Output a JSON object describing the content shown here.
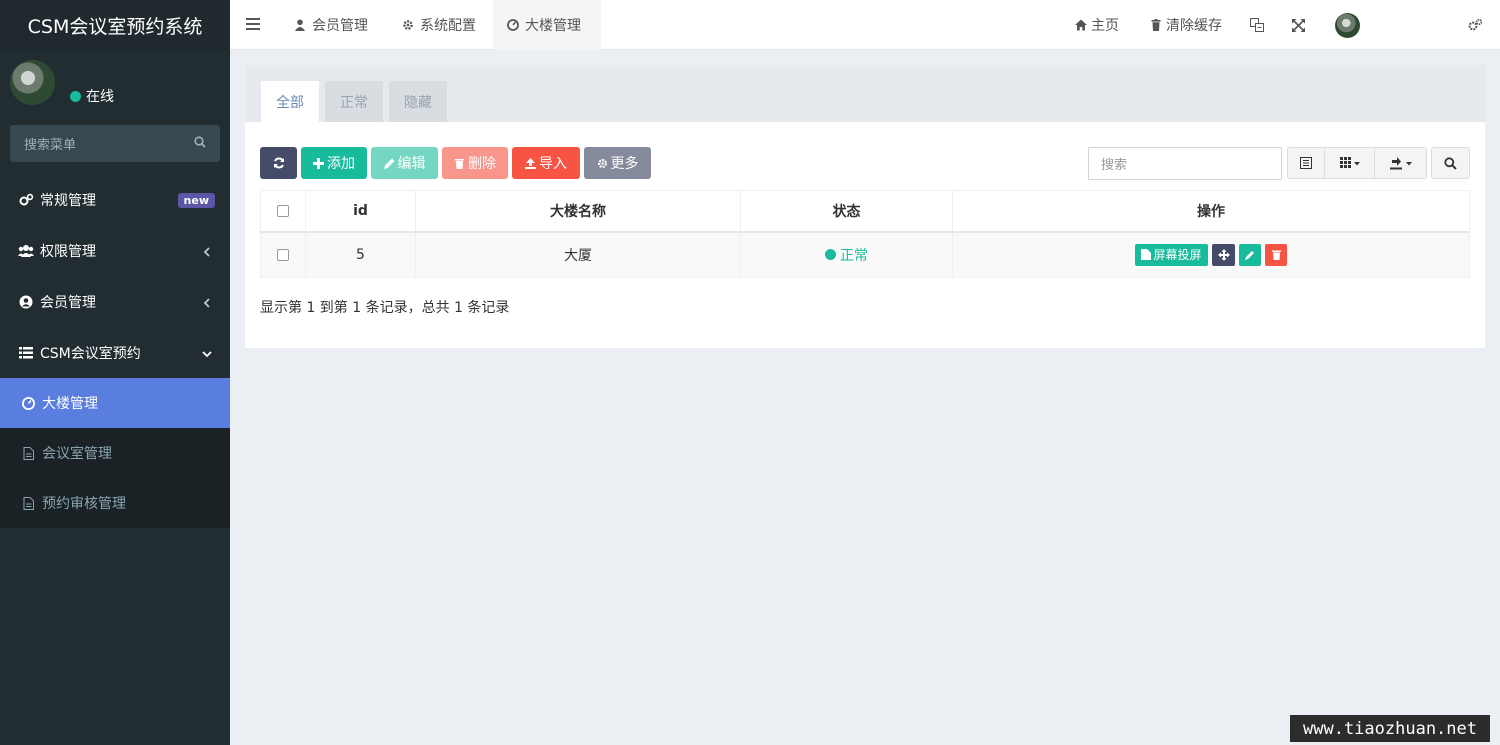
{
  "brand": "CSM会议室预约系统",
  "user": {
    "status": "在线"
  },
  "sidebar": {
    "search_placeholder": "搜索菜单",
    "items": [
      {
        "label": "常规管理",
        "badge": "new"
      },
      {
        "label": "权限管理"
      },
      {
        "label": "会员管理"
      },
      {
        "label": "CSM会议室预约"
      }
    ],
    "subitems": [
      {
        "label": "大楼管理"
      },
      {
        "label": "会议室管理"
      },
      {
        "label": "预约审核管理"
      }
    ]
  },
  "topbar": {
    "tabs": [
      {
        "label": "会员管理"
      },
      {
        "label": "系统配置"
      },
      {
        "label": "大楼管理"
      }
    ],
    "home": "主页",
    "clear_cache": "清除缓存"
  },
  "panel": {
    "tabs": [
      "全部",
      "正常",
      "隐藏"
    ],
    "buttons": {
      "add": "添加",
      "edit": "编辑",
      "delete": "删除",
      "import": "导入",
      "more": "更多"
    },
    "search_placeholder": "搜索",
    "table": {
      "headers": [
        "id",
        "大楼名称",
        "状态",
        "操作"
      ],
      "rows": [
        {
          "id": "5",
          "name": "大厦",
          "status": "正常",
          "screen_btn": "屏幕投屏"
        }
      ]
    },
    "summary": "显示第 1 到第 1 条记录，总共 1 条记录"
  },
  "watermark": "www.tiaozhuan.net",
  "colors": {
    "accent": "#18bc9c",
    "danger": "#f75444",
    "primary": "#444c69",
    "sidebar": "#222d32",
    "active": "#5a7ee0"
  }
}
